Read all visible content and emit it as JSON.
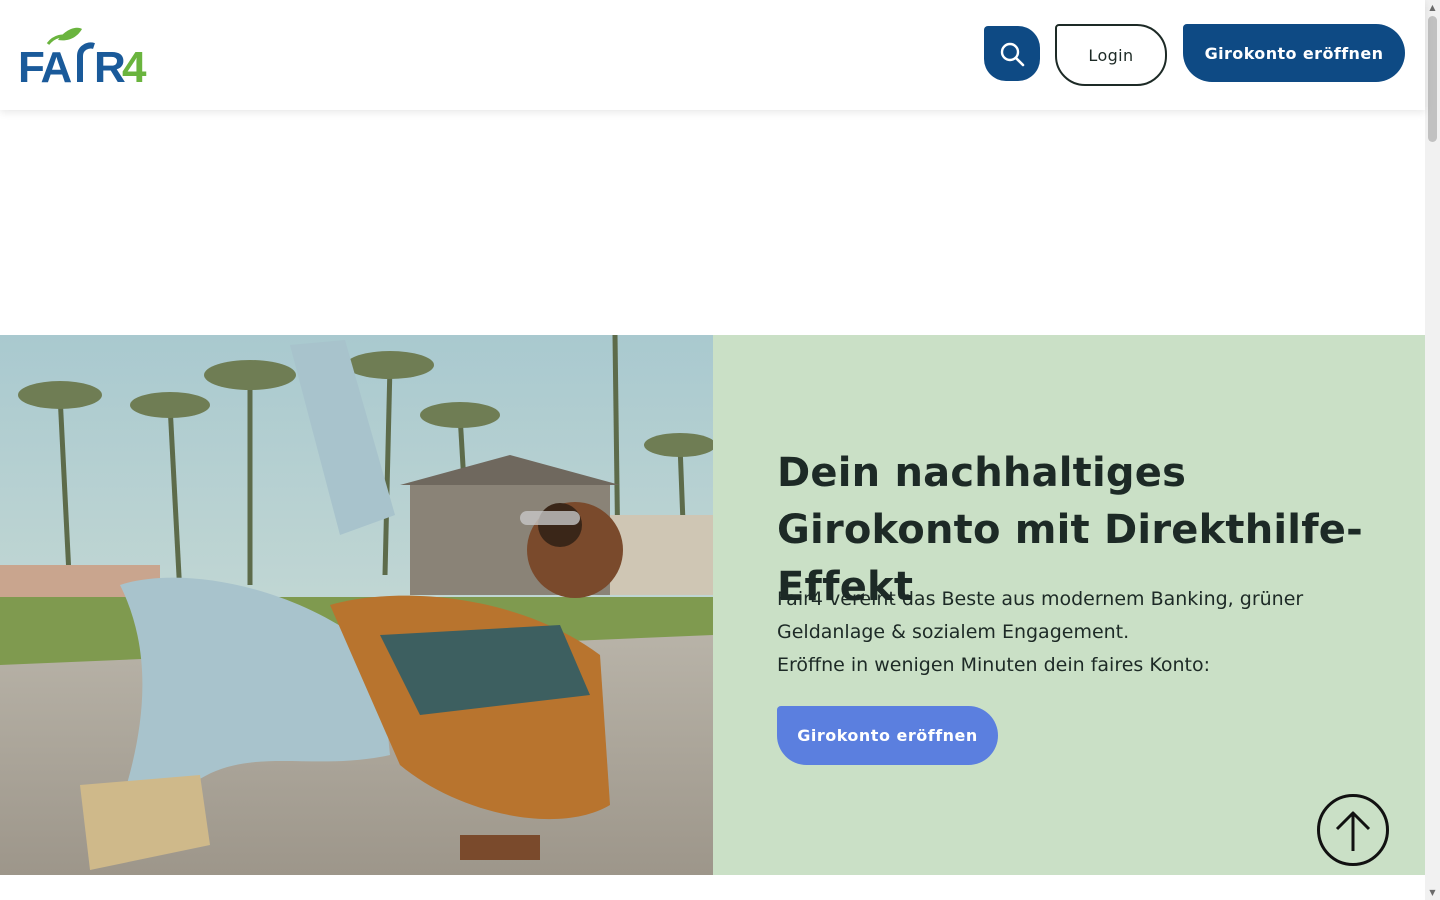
{
  "header": {
    "logo_text": "FAIR4",
    "search_icon": "search-icon",
    "login_label": "Login",
    "open_account_label": "Girokonto eröffnen"
  },
  "hero": {
    "image_alt": "woman-skating-photo",
    "title": "Dein nachhaltiges Girokonto mit Direkthilfe-Effekt",
    "text_lines": [
      "Fair4 vereint das Beste aus modernem Banking, grüner",
      "Geldanlage & sozialem Engagement.",
      "Eröffne in wenigen Minuten dein faires Konto:"
    ],
    "cta_label": "Girokonto eröffnen",
    "scroll_top_icon": "arrow-up-circle-icon"
  },
  "colors": {
    "primary_blue": "#0e4a84",
    "cta_blue": "#5b7fdf",
    "hero_green": "#cae0c6",
    "logo_green": "#6ab43e",
    "text_dark": "#1d2a26"
  }
}
